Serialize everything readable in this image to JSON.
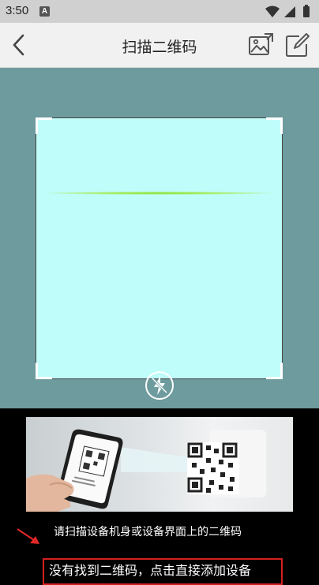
{
  "status_bar": {
    "time": "3:50",
    "notification_badge": "A",
    "icons": [
      "wifi-icon",
      "signal-icon",
      "battery-icon"
    ]
  },
  "app_bar": {
    "title": "扫描二维码",
    "back_icon": "chevron-left-icon",
    "gallery_icon": "image-icon",
    "edit_icon": "edit-icon"
  },
  "scanner": {
    "flash_icon": "flash-icon",
    "frame_color": "#bffdfa",
    "background_color": "#6e9b9d",
    "scan_line_color": "#7cde3a"
  },
  "guide": {
    "hint": "请扫描设备机身或设备界面上的二维码",
    "manual_add": "没有找到二维码，点击直接添加设备",
    "accent_color": "#d62020"
  }
}
